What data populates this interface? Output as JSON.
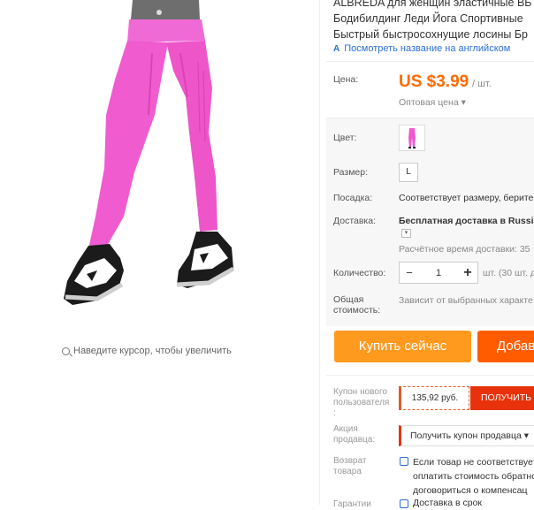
{
  "product": {
    "title_lines": [
      "ALBREDA для женщин эластичные ВЬ",
      "Бодибилдинг Леди Йога Спортивные",
      "Быстрый быстросохнущие лосины Бр"
    ],
    "translate_link": "Посмотреть название на английском",
    "zoom_hint": "Наведите курсор, чтобы увеличить"
  },
  "price": {
    "label": "Цена:",
    "value": "US $3.99",
    "per": "/ шт.",
    "wholesale": "Оптовая цена ▾"
  },
  "attributes": {
    "color_label": "Цвет:",
    "size_label": "Размер:",
    "size_value": "L",
    "fit_label": "Посадка:",
    "fit_value": "Соответствует размеру, берите",
    "shipping_label": "Доставка:",
    "shipping_value": "Бесплатная доставка в Russia",
    "delivery_estimate": "Расчётное время доставки: 35",
    "quantity_label": "Количество:",
    "quantity_value": "1",
    "quantity_unit": "шт. (30 шт. д",
    "total_label_1": "Общая",
    "total_label_2": "стоимость:",
    "total_value": "Зависит от выбранных характе"
  },
  "actions": {
    "buy_now": "Купить сейчас",
    "add_to_cart": "Добав"
  },
  "promos": {
    "new_user_coupon_label": [
      "Купон нового",
      "пользователя",
      ":"
    ],
    "new_user_coupon_value": "135,92 руб.",
    "new_user_coupon_button": "ПОЛУЧИТЬ",
    "seller_promo_label": [
      "Акция",
      "продавца:"
    ],
    "seller_promo_button": "Получить купон продавца ▾",
    "return_label": [
      "Возврат",
      "товара"
    ],
    "return_text": [
      "Если товар не соответствует",
      "оплатить стоимость обратно",
      "договориться о компенсац"
    ],
    "guarantee_label": "Гарантии",
    "guarantee_text": "Доставка в срок"
  },
  "colors": {
    "accent_orange": "#ff6a00",
    "buy_button": "#ff9a1f",
    "cart_button": "#ff5c00",
    "coupon_red": "#e8320b",
    "link_blue": "#2c6fd6",
    "leggings_pink": "#f05bd0"
  }
}
